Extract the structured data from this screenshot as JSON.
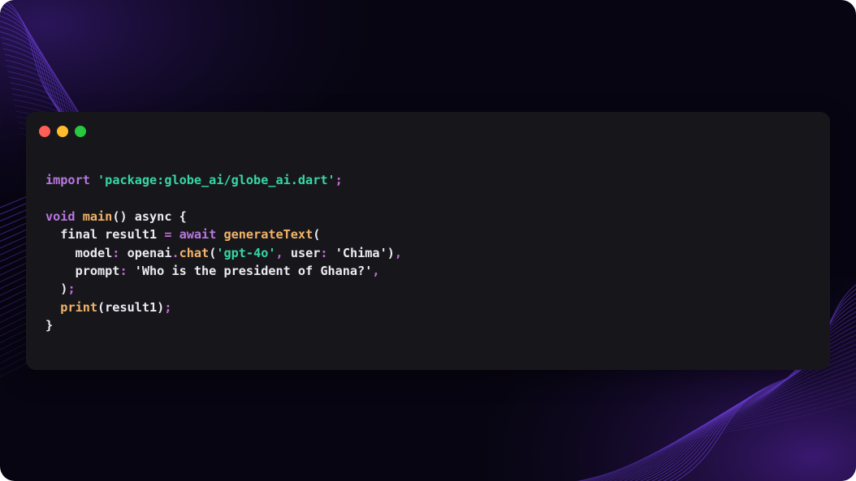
{
  "colors": {
    "background": "#070511",
    "window": "#17171b",
    "wave": "#6b3fd6",
    "keyword": "#b877e0",
    "string": "#36d7a6",
    "function": "#f3b46a",
    "operator": "#c56ad8",
    "text": "#ecebf2"
  },
  "window": {
    "dots": [
      {
        "name": "close",
        "color": "#ff5f57"
      },
      {
        "name": "minimize",
        "color": "#febc2e"
      },
      {
        "name": "maximize",
        "color": "#28c840"
      }
    ]
  },
  "code": {
    "language": "dart",
    "lines": [
      [
        {
          "t": "kw",
          "v": "import"
        },
        {
          "t": "id",
          "v": " "
        },
        {
          "t": "str",
          "v": "'package:globe_ai/globe_ai.dart'"
        },
        {
          "t": "op",
          "v": ";"
        }
      ],
      [],
      [
        {
          "t": "kw",
          "v": "void"
        },
        {
          "t": "id",
          "v": " "
        },
        {
          "t": "fn",
          "v": "main"
        },
        {
          "t": "id",
          "v": "() async {"
        }
      ],
      [
        {
          "t": "id",
          "v": "  final result1 "
        },
        {
          "t": "op",
          "v": "="
        },
        {
          "t": "id",
          "v": " "
        },
        {
          "t": "kw",
          "v": "await"
        },
        {
          "t": "id",
          "v": " "
        },
        {
          "t": "fn",
          "v": "generateText"
        },
        {
          "t": "id",
          "v": "("
        }
      ],
      [
        {
          "t": "id",
          "v": "    model"
        },
        {
          "t": "op",
          "v": ":"
        },
        {
          "t": "id",
          "v": " openai"
        },
        {
          "t": "op",
          "v": "."
        },
        {
          "t": "fn",
          "v": "chat"
        },
        {
          "t": "id",
          "v": "("
        },
        {
          "t": "str",
          "v": "'gpt-4o'"
        },
        {
          "t": "op",
          "v": ","
        },
        {
          "t": "id",
          "v": " user"
        },
        {
          "t": "op",
          "v": ":"
        },
        {
          "t": "id",
          "v": " "
        },
        {
          "t": "sq",
          "v": "'Chima'"
        },
        {
          "t": "id",
          "v": ")"
        },
        {
          "t": "op",
          "v": ","
        }
      ],
      [
        {
          "t": "id",
          "v": "    prompt"
        },
        {
          "t": "op",
          "v": ":"
        },
        {
          "t": "id",
          "v": " "
        },
        {
          "t": "sq",
          "v": "'Who is the president of Ghana?'"
        },
        {
          "t": "op",
          "v": ","
        }
      ],
      [
        {
          "t": "id",
          "v": "  )"
        },
        {
          "t": "op",
          "v": ";"
        }
      ],
      [
        {
          "t": "id",
          "v": "  "
        },
        {
          "t": "fn",
          "v": "print"
        },
        {
          "t": "id",
          "v": "(result1)"
        },
        {
          "t": "op",
          "v": ";"
        }
      ],
      [
        {
          "t": "id",
          "v": "}"
        }
      ]
    ]
  }
}
